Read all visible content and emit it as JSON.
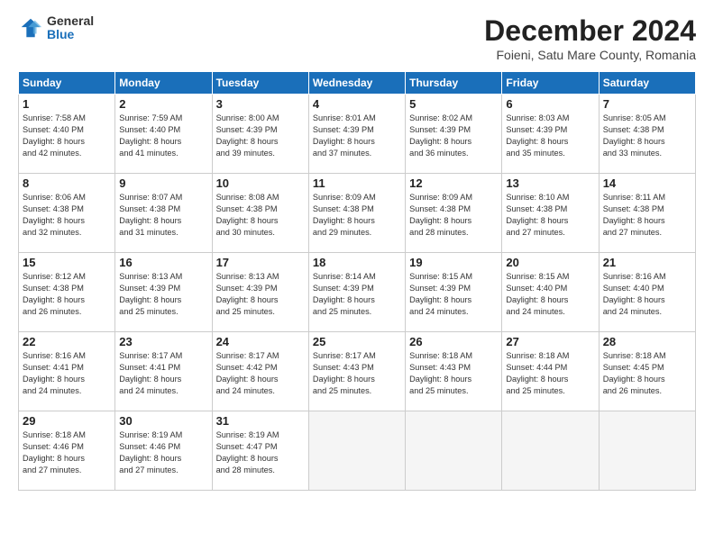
{
  "logo": {
    "general": "General",
    "blue": "Blue"
  },
  "title": "December 2024",
  "subtitle": "Foieni, Satu Mare County, Romania",
  "headers": [
    "Sunday",
    "Monday",
    "Tuesday",
    "Wednesday",
    "Thursday",
    "Friday",
    "Saturday"
  ],
  "weeks": [
    [
      {
        "day": "1",
        "info": "Sunrise: 7:58 AM\nSunset: 4:40 PM\nDaylight: 8 hours\nand 42 minutes."
      },
      {
        "day": "2",
        "info": "Sunrise: 7:59 AM\nSunset: 4:40 PM\nDaylight: 8 hours\nand 41 minutes."
      },
      {
        "day": "3",
        "info": "Sunrise: 8:00 AM\nSunset: 4:39 PM\nDaylight: 8 hours\nand 39 minutes."
      },
      {
        "day": "4",
        "info": "Sunrise: 8:01 AM\nSunset: 4:39 PM\nDaylight: 8 hours\nand 37 minutes."
      },
      {
        "day": "5",
        "info": "Sunrise: 8:02 AM\nSunset: 4:39 PM\nDaylight: 8 hours\nand 36 minutes."
      },
      {
        "day": "6",
        "info": "Sunrise: 8:03 AM\nSunset: 4:39 PM\nDaylight: 8 hours\nand 35 minutes."
      },
      {
        "day": "7",
        "info": "Sunrise: 8:05 AM\nSunset: 4:38 PM\nDaylight: 8 hours\nand 33 minutes."
      }
    ],
    [
      {
        "day": "8",
        "info": "Sunrise: 8:06 AM\nSunset: 4:38 PM\nDaylight: 8 hours\nand 32 minutes."
      },
      {
        "day": "9",
        "info": "Sunrise: 8:07 AM\nSunset: 4:38 PM\nDaylight: 8 hours\nand 31 minutes."
      },
      {
        "day": "10",
        "info": "Sunrise: 8:08 AM\nSunset: 4:38 PM\nDaylight: 8 hours\nand 30 minutes."
      },
      {
        "day": "11",
        "info": "Sunrise: 8:09 AM\nSunset: 4:38 PM\nDaylight: 8 hours\nand 29 minutes."
      },
      {
        "day": "12",
        "info": "Sunrise: 8:09 AM\nSunset: 4:38 PM\nDaylight: 8 hours\nand 28 minutes."
      },
      {
        "day": "13",
        "info": "Sunrise: 8:10 AM\nSunset: 4:38 PM\nDaylight: 8 hours\nand 27 minutes."
      },
      {
        "day": "14",
        "info": "Sunrise: 8:11 AM\nSunset: 4:38 PM\nDaylight: 8 hours\nand 27 minutes."
      }
    ],
    [
      {
        "day": "15",
        "info": "Sunrise: 8:12 AM\nSunset: 4:38 PM\nDaylight: 8 hours\nand 26 minutes."
      },
      {
        "day": "16",
        "info": "Sunrise: 8:13 AM\nSunset: 4:39 PM\nDaylight: 8 hours\nand 25 minutes."
      },
      {
        "day": "17",
        "info": "Sunrise: 8:13 AM\nSunset: 4:39 PM\nDaylight: 8 hours\nand 25 minutes."
      },
      {
        "day": "18",
        "info": "Sunrise: 8:14 AM\nSunset: 4:39 PM\nDaylight: 8 hours\nand 25 minutes."
      },
      {
        "day": "19",
        "info": "Sunrise: 8:15 AM\nSunset: 4:39 PM\nDaylight: 8 hours\nand 24 minutes."
      },
      {
        "day": "20",
        "info": "Sunrise: 8:15 AM\nSunset: 4:40 PM\nDaylight: 8 hours\nand 24 minutes."
      },
      {
        "day": "21",
        "info": "Sunrise: 8:16 AM\nSunset: 4:40 PM\nDaylight: 8 hours\nand 24 minutes."
      }
    ],
    [
      {
        "day": "22",
        "info": "Sunrise: 8:16 AM\nSunset: 4:41 PM\nDaylight: 8 hours\nand 24 minutes."
      },
      {
        "day": "23",
        "info": "Sunrise: 8:17 AM\nSunset: 4:41 PM\nDaylight: 8 hours\nand 24 minutes."
      },
      {
        "day": "24",
        "info": "Sunrise: 8:17 AM\nSunset: 4:42 PM\nDaylight: 8 hours\nand 24 minutes."
      },
      {
        "day": "25",
        "info": "Sunrise: 8:17 AM\nSunset: 4:43 PM\nDaylight: 8 hours\nand 25 minutes."
      },
      {
        "day": "26",
        "info": "Sunrise: 8:18 AM\nSunset: 4:43 PM\nDaylight: 8 hours\nand 25 minutes."
      },
      {
        "day": "27",
        "info": "Sunrise: 8:18 AM\nSunset: 4:44 PM\nDaylight: 8 hours\nand 25 minutes."
      },
      {
        "day": "28",
        "info": "Sunrise: 8:18 AM\nSunset: 4:45 PM\nDaylight: 8 hours\nand 26 minutes."
      }
    ],
    [
      {
        "day": "29",
        "info": "Sunrise: 8:18 AM\nSunset: 4:46 PM\nDaylight: 8 hours\nand 27 minutes."
      },
      {
        "day": "30",
        "info": "Sunrise: 8:19 AM\nSunset: 4:46 PM\nDaylight: 8 hours\nand 27 minutes."
      },
      {
        "day": "31",
        "info": "Sunrise: 8:19 AM\nSunset: 4:47 PM\nDaylight: 8 hours\nand 28 minutes."
      },
      null,
      null,
      null,
      null
    ]
  ]
}
